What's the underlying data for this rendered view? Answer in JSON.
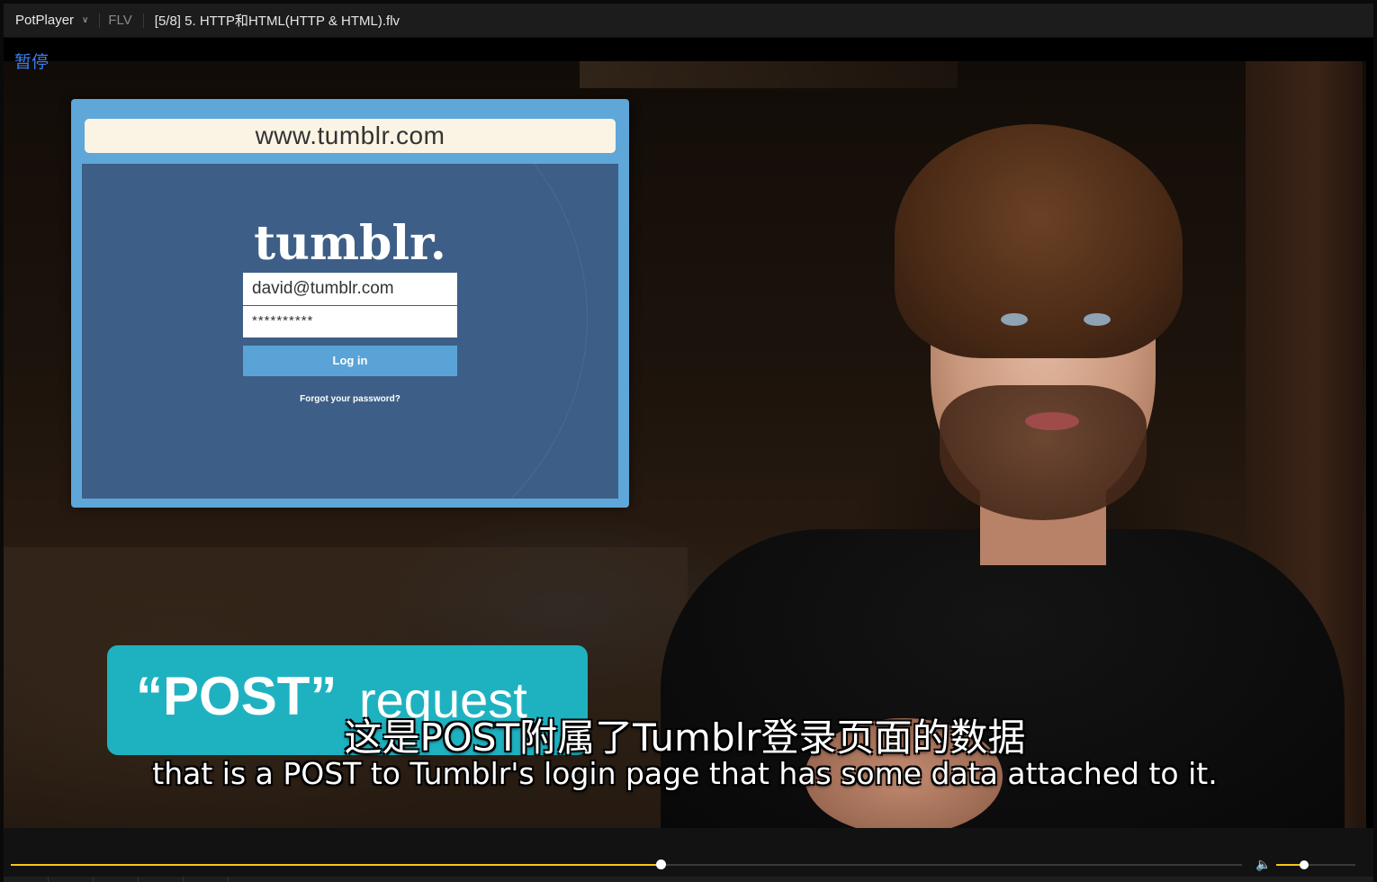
{
  "titlebar": {
    "app_name": "PotPlayer",
    "format": "FLV",
    "file_title": "[5/8] 5. HTTP和HTML(HTTP & HTML).flv"
  },
  "osd": {
    "status": "暂停"
  },
  "video": {
    "tumblr": {
      "url": "www.tumblr.com",
      "logo": "tumblr.",
      "email": "david@tumblr.com",
      "password": "**********",
      "login_label": "Log in",
      "forgot_label": "Forgot your password?"
    },
    "banner": {
      "method": "“POST”",
      "word": "request"
    },
    "subtitles": {
      "chinese": "这是POST附属了Tumblr登录页面的数据",
      "english": "that is a POST to Tumblr's login page that has some data attached to it."
    }
  },
  "controls": {
    "progress_fraction": 0.528,
    "volume_fraction": 0.35,
    "accent_color": "#f5c518"
  },
  "colors": {
    "osd_text": "#3b7ff0",
    "tumblr_blue": "#3d5e86",
    "banner_teal": "#1eb2c0"
  }
}
